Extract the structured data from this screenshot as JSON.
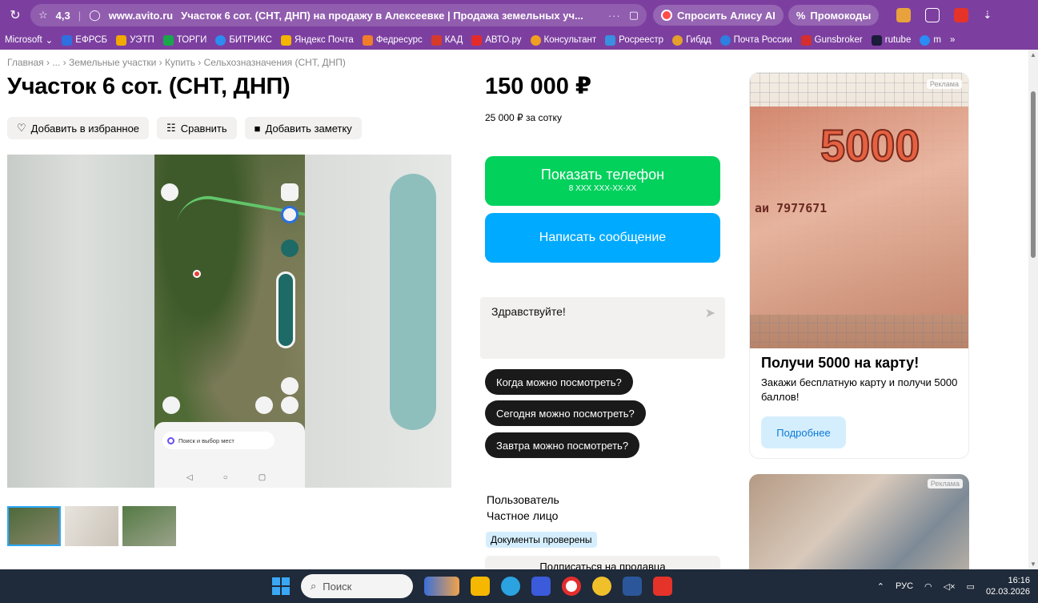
{
  "browser": {
    "rating": "4,3",
    "domain": "www.avito.ru",
    "page_title": "Участок 6 сот. (СНТ, ДНП) на продажу в Алексеевке | Продажа земельных уч...",
    "alisa_label": "Спросить Алису AI",
    "promo_label": "Промокоды",
    "bookmarks": [
      "Microsoft",
      "ЕФРСБ",
      "УЭТП",
      "ТОРГИ",
      "БИТРИКС",
      "Яндекс Почта",
      "Федресурс",
      "КАД",
      "АВТО.ру",
      "Консультант",
      "Росреестр",
      "Гибдд",
      "Почта России",
      "Gunsbroker",
      "rutube",
      "m",
      "»"
    ]
  },
  "listing": {
    "breadcrumb": "Главная › ... › Земельные участки › Купить › Сельхозназначения (СНТ, ДНП)",
    "title": "Участок 6 сот. (СНТ, ДНП)",
    "actions": {
      "favorite": "Добавить в избранное",
      "compare": "Сравнить",
      "note": "Добавить заметку"
    },
    "price": "150 000 ₽",
    "price_per": "25 000 ₽ за сотку",
    "show_phone": "Показать телефон",
    "phone_mask": "8 XXX XXX-XX-XX",
    "write_message": "Написать сообщение",
    "chat_placeholder": "Здравствуйте!",
    "quick_questions": [
      "Когда можно посмотреть?",
      "Сегодня можно посмотреть?",
      "Завтра можно посмотреть?"
    ],
    "seller_name": "Пользователь",
    "seller_type": "Частное лицо",
    "verified_badge": "Документы проверены",
    "subscribe": "Подписаться на продавца",
    "phone_screenshot": {
      "search_placeholder": "Поиск и выбор мест"
    }
  },
  "ads": [
    {
      "label": "Реклама",
      "banknote_value": "5000",
      "banknote_serial": "аи 7977671",
      "title": "Получи 5000 на карту!",
      "text": "Закажи бесплатную карту и получи 5000 баллов!",
      "button": "Подробнее"
    },
    {
      "label": "Реклама"
    }
  ],
  "taskbar": {
    "search_placeholder": "Поиск",
    "lang": "РУС",
    "time": "16:16",
    "date": "02.03.2026"
  },
  "colors": {
    "browser_chrome": "#7c3fa0",
    "phone_button": "#02d15c",
    "message_button": "#00aaff",
    "taskbar": "#1f2a3a"
  }
}
